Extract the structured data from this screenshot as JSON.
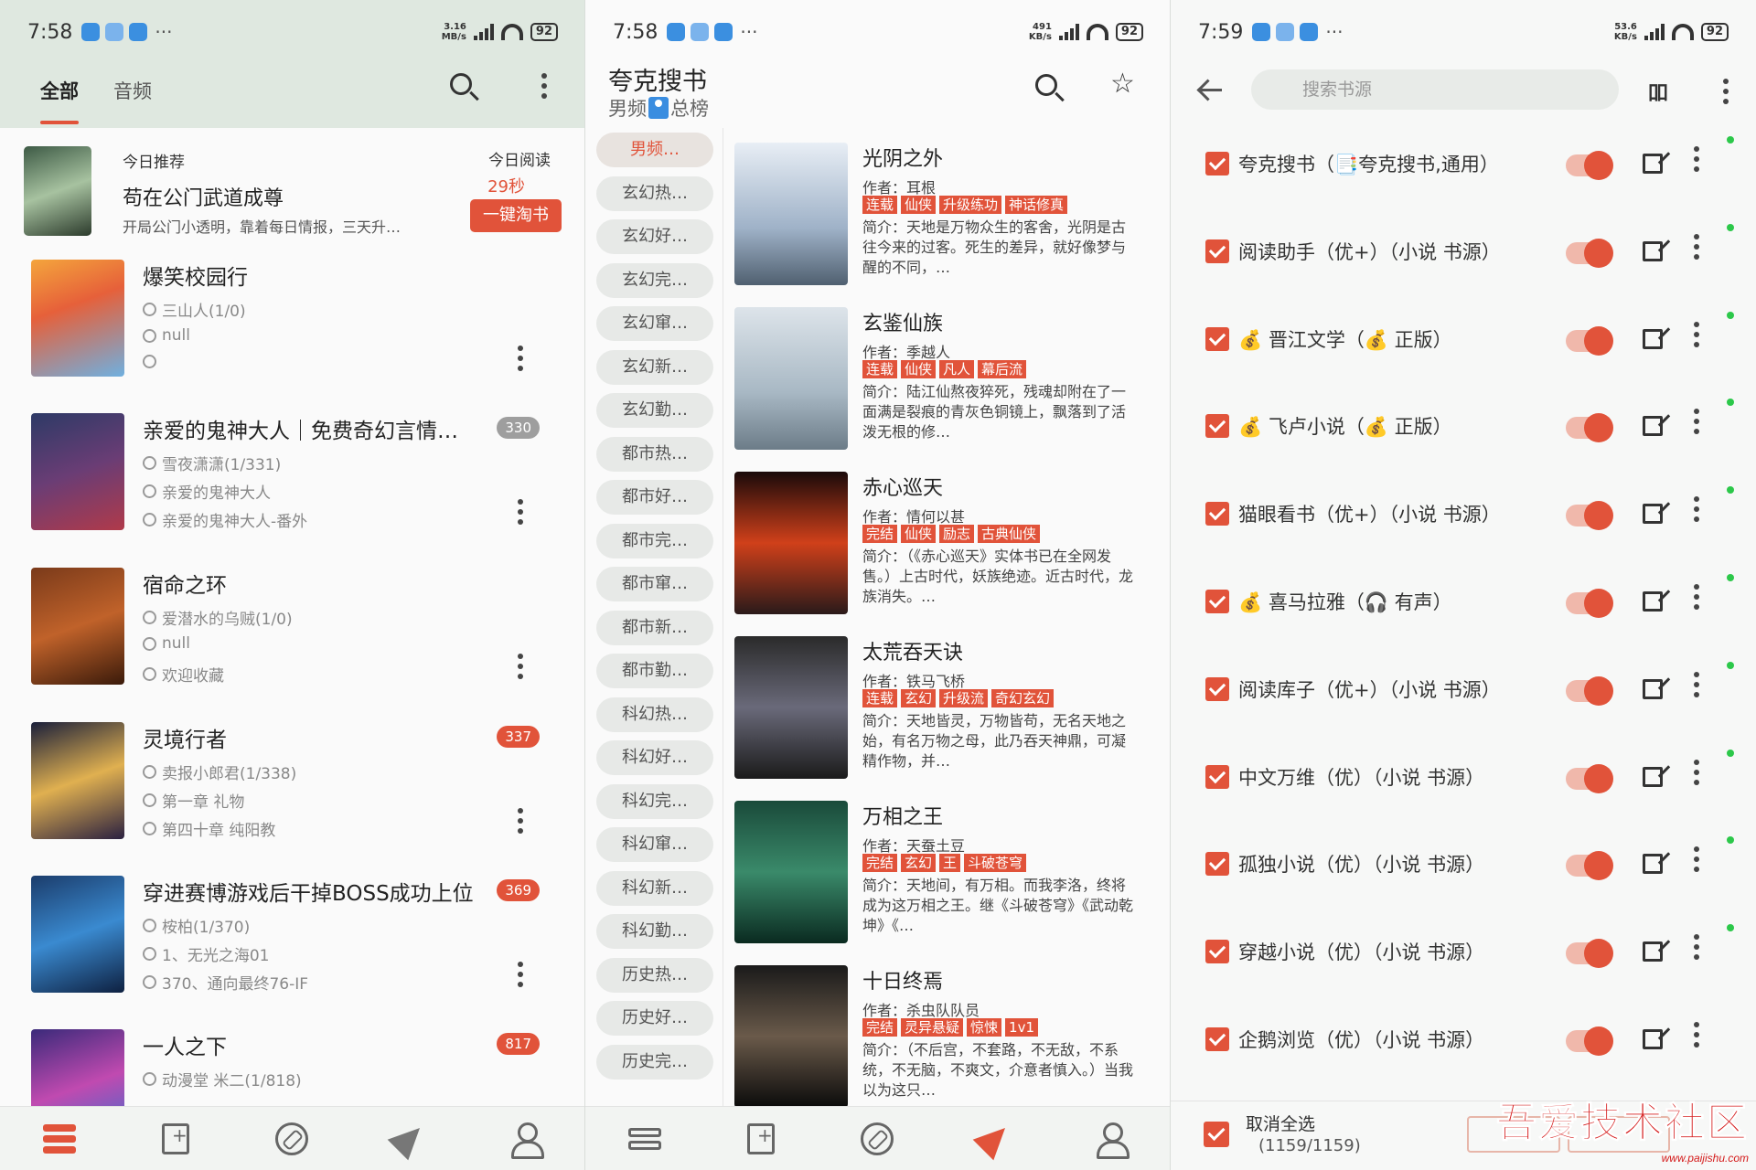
{
  "panel1": {
    "status": {
      "time": "7:58",
      "speed_top": "3.16",
      "speed_bottom": "MB/s",
      "battery": "92"
    },
    "tabs": [
      "全部",
      "音频"
    ],
    "recommend": {
      "label": "今日推荐",
      "title": "苟在公门武道成尊",
      "desc": "开局公门小透明，靠着每日情报，三天升…",
      "today_read_label": "今日阅读",
      "today_read_value": "29秒",
      "button": "一键淘书"
    },
    "books": [
      {
        "title": "爆笑校园行",
        "author": "三山人(1/0)",
        "latest": "null",
        "read": "",
        "badge": ""
      },
      {
        "title": "亲爱的鬼神大人｜免费奇幻言情…",
        "author": "雪夜潇潇(1/331)",
        "latest": "亲爱的鬼神大人",
        "read": "亲爱的鬼神大人-番外",
        "badge": "330"
      },
      {
        "title": "宿命之环",
        "author": "爱潜水的乌贼(1/0)",
        "latest": "null",
        "read": "欢迎收藏",
        "badge": ""
      },
      {
        "title": "灵境行者",
        "author": "卖报小郎君(1/338)",
        "latest": "第一章 礼物",
        "read": "第四十章 纯阳教",
        "badge": "337"
      },
      {
        "title": "穿进赛博游戏后干掉BOSS成功上位",
        "author": "桉柏(1/370)",
        "latest": "1、无光之海01",
        "read": "370、通向最终76-IF",
        "badge": "369"
      },
      {
        "title": "一人之下",
        "author": "动漫堂 米二(1/818)",
        "latest": "",
        "read": "",
        "badge": "817"
      }
    ]
  },
  "panel2": {
    "status": {
      "time": "7:58",
      "speed_top": "491",
      "speed_bottom": "KB/s",
      "battery": "92"
    },
    "title": "夸克搜书",
    "subtitle_left": "男频",
    "subtitle_right": "总榜",
    "categories": [
      "男频…",
      "玄幻热…",
      "玄幻好…",
      "玄幻完…",
      "玄幻窜…",
      "玄幻新…",
      "玄幻勤…",
      "都市热…",
      "都市好…",
      "都市完…",
      "都市窜…",
      "都市新…",
      "都市勤…",
      "科幻热…",
      "科幻好…",
      "科幻完…",
      "科幻窜…",
      "科幻新…",
      "科幻勤…",
      "历史热…",
      "历史好…",
      "历史完…"
    ],
    "books": [
      {
        "title": "光阴之外",
        "author": "作者：耳根",
        "tags": [
          "连载",
          "仙侠",
          "升级练功",
          "神话修真"
        ],
        "intro": "简介：天地是万物众生的客舍，光阴是古往今来的过客。死生的差异，就好像梦与醒的不同，…"
      },
      {
        "title": "玄鉴仙族",
        "author": "作者：季越人",
        "tags": [
          "连载",
          "仙侠",
          "凡人",
          "幕后流"
        ],
        "intro": "简介：陆江仙熬夜猝死，残魂却附在了一面满是裂痕的青灰色铜镜上，飘落到了活泼无根的修…"
      },
      {
        "title": "赤心巡天",
        "author": "作者：情何以甚",
        "tags": [
          "完结",
          "仙侠",
          "励志",
          "古典仙侠"
        ],
        "intro": "简介：（《赤心巡天》实体书已在全网发售。）上古时代，妖族绝迹。近古时代，龙族消失。…"
      },
      {
        "title": "太荒吞天诀",
        "author": "作者：铁马飞桥",
        "tags": [
          "连载",
          "玄幻",
          "升级流",
          "奇幻玄幻"
        ],
        "intro": "简介：天地皆灵，万物皆苟，无名天地之始，有名万物之母，此乃吞天神鼎，可凝精作物，并…"
      },
      {
        "title": "万相之王",
        "author": "作者：天蚕土豆",
        "tags": [
          "完结",
          "玄幻",
          "王",
          "斗破苍穹"
        ],
        "intro": "简介：天地间，有万相。而我李洛，终将成为这万相之王。继《斗破苍穹》《武动乾坤》《…"
      },
      {
        "title": "十日终焉",
        "author": "作者：杀虫队队员",
        "tags": [
          "完结",
          "灵异悬疑",
          "惊悚",
          "1v1"
        ],
        "intro": "简介：（不后宫，不套路，不无敌，不系统，不无脑，不爽文，介意者慎入。）当我以为这只…"
      }
    ]
  },
  "panel3": {
    "status": {
      "time": "7:59",
      "speed_top": "53.6",
      "speed_bottom": "KB/s",
      "battery": "92"
    },
    "search_placeholder": "搜索书源",
    "group_icon": "吅",
    "sources": [
      "夸克搜书（📑夸克搜书,通用）",
      "阅读助手（优+）（小说 书源）",
      "💰 晋江文学（💰 正版）",
      "💰 飞卢小说（💰 正版）",
      "猫眼看书（优+）（小说 书源）",
      "💰 喜马拉雅（🎧 有声）",
      "阅读库子（优+）（小说 书源）",
      "中文万维（优）（小说 书源）",
      "孤独小说（优）（小说 书源）",
      "穿越小说（优）（小说 书源）",
      "企鹅浏览（优）（小说 书源）"
    ],
    "footer": {
      "deselect": "取消全选",
      "count": "(1159/1159)"
    },
    "watermark": "吾爱技术社区",
    "watermark_url": "www.paijishu.com"
  },
  "colors": {
    "accent": "#e1533a",
    "online": "#2cc84a",
    "topbar": "#dfe8e0"
  }
}
